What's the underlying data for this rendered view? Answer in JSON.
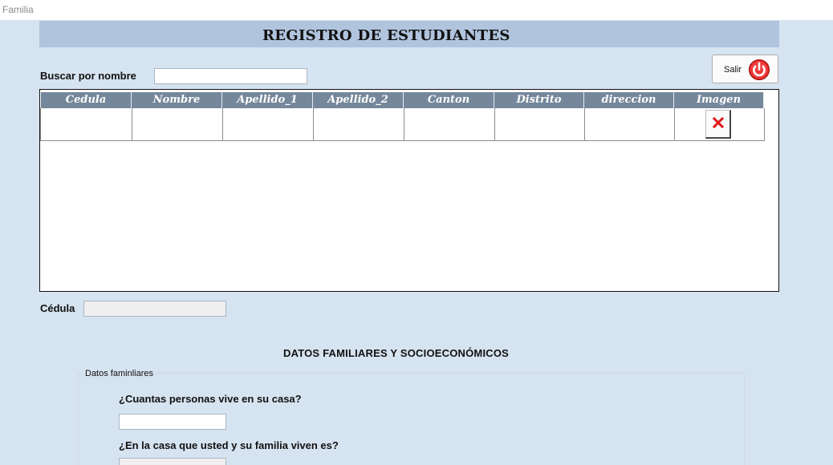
{
  "window": {
    "title": "Familia"
  },
  "header": {
    "title": "REGISTRO DE ESTUDIANTES"
  },
  "search": {
    "label": "Buscar por nombre",
    "value": ""
  },
  "exit_button": {
    "label": "Salir",
    "icon": "power-icon",
    "icon_color": "#e02020"
  },
  "grid": {
    "columns": [
      "Cedula",
      "Nombre",
      "Apellido_1",
      "Apellido_2",
      "Canton",
      "Distrito",
      "direccion",
      "Imagen"
    ],
    "header_color": "#75879a",
    "rows": [
      {
        "Cedula": "",
        "Nombre": "",
        "Apellido_1": "",
        "Apellido_2": "",
        "Canton": "",
        "Distrito": "",
        "direccion": "",
        "Imagen": "broken-image-icon"
      }
    ]
  },
  "cedula": {
    "label": "Cédula",
    "value": ""
  },
  "family_section": {
    "title": "DATOS FAMILIARES Y SOCIOECONÓMICOS",
    "group_label": "Datos faminliares",
    "question_people": "¿Cuantas personas vive en su casa?",
    "people_value": "",
    "question_house": "¿En la casa que usted y su familia viven es?",
    "house_value": ""
  },
  "colors": {
    "background": "#d6e3f0",
    "header_band": "#b0c4de"
  }
}
